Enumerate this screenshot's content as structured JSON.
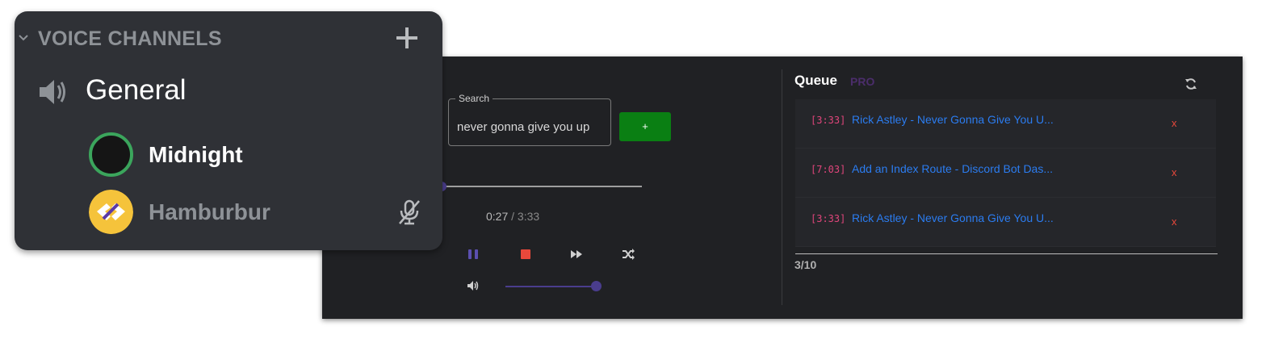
{
  "voice_panel": {
    "header": "VOICE CHANNELS",
    "channel_name": "General",
    "members": [
      {
        "name": "Midnight",
        "speaking": true
      },
      {
        "name": "Hamburbur",
        "muted": true
      }
    ]
  },
  "player": {
    "search": {
      "legend": "Search",
      "value": "never gonna give you up"
    },
    "add_label": "+",
    "time": {
      "current": "0:27",
      "separator": " / ",
      "total": "3:33"
    },
    "progress": 0.0,
    "volume": 1.0,
    "controls": [
      "pause-icon",
      "stop-icon",
      "skip-icon",
      "shuffle-icon"
    ]
  },
  "queue": {
    "title": "Queue",
    "badge": "PRO",
    "items": [
      {
        "duration": "[3:33]",
        "title": "Rick Astley - Never Gonna Give You U...",
        "remove": "x"
      },
      {
        "duration": "[7:03]",
        "title": "Add an Index Route - Discord Bot Das...",
        "remove": "x"
      },
      {
        "duration": "[3:33]",
        "title": "Rick Astley - Never Gonna Give You U...",
        "remove": "x"
      }
    ],
    "count": "3",
    "count_max": "/10"
  },
  "colors": {
    "accent": "#4a3d8d",
    "add_button": "#0a7f13",
    "stop": "#e8483b",
    "duration": "#e0457b",
    "link": "#2b7cf0",
    "speaking_ring": "#3ba55c",
    "hamburbur_avatar": "#f5c33b"
  }
}
